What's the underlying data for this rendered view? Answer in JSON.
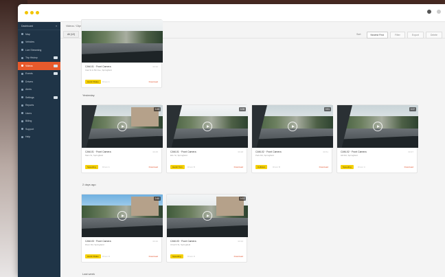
{
  "app": {
    "title": "Videos / Clips"
  },
  "sidebar": {
    "header": "Dashboard",
    "items": [
      {
        "label": "Map",
        "active": false,
        "badge": false
      },
      {
        "label": "Vehicles",
        "active": false,
        "badge": false
      },
      {
        "label": "Live Streaming",
        "active": false,
        "badge": false
      },
      {
        "label": "Trip History",
        "active": false,
        "badge": true
      },
      {
        "label": "Videos",
        "active": true,
        "badge": true
      },
      {
        "label": "Events",
        "active": false,
        "badge": true
      },
      {
        "label": "Drivers",
        "active": false,
        "badge": false
      },
      {
        "label": "Alerts",
        "active": false,
        "badge": false
      },
      {
        "label": "Settings",
        "active": false,
        "badge": true
      },
      {
        "label": "Reports",
        "active": false,
        "badge": false
      },
      {
        "label": "Users",
        "active": false,
        "badge": false
      },
      {
        "label": "Billing",
        "active": false,
        "badge": false
      },
      {
        "label": "Support",
        "active": false,
        "badge": false
      },
      {
        "label": "Help",
        "active": false,
        "badge": false
      }
    ]
  },
  "toolbar": {
    "breadcrumb": "Videos / Clips",
    "tabs": [
      "All (12)",
      "Uploaded",
      "Processing",
      "Requested"
    ],
    "sort_label": "Sort",
    "sort_value": "Newest First",
    "btn_filter": "Filter",
    "btn_export": "Export",
    "btn_delete": "Delete"
  },
  "groups": [
    {
      "title": ""
    },
    {
      "title": "Yesterday"
    },
    {
      "title": "2 days ago"
    },
    {
      "title": "Last week"
    }
  ],
  "cards": [
    {
      "title": "CAM-01 · Front Camera",
      "sub": "Oak St & 5th Ave, Springfield",
      "meta": "00:32",
      "tag": "Harsh Brake",
      "tag2": "Driver A",
      "action": "Download"
    },
    {
      "title": "CAM-01 · Front Camera",
      "sub": "Main St, Springfield",
      "meta": "00:45",
      "duration": "0:45",
      "tag": "Speeding",
      "tag2": "Driver A",
      "action": "Download"
    },
    {
      "title": "CAM-01 · Front Camera",
      "sub": "Elm St, Springfield",
      "meta": "00:28",
      "duration": "0:28",
      "tag": "Harsh Turn",
      "tag2": "Driver B",
      "action": "Download"
    },
    {
      "title": "CAM-02 · Front Camera",
      "sub": "Park Rd, Springfield",
      "meta": "00:51",
      "duration": "0:51",
      "tag": "Collision",
      "tag2": "Driver B",
      "action": "Download"
    },
    {
      "title": "CAM-02 · Front Camera",
      "sub": "Hill Rd, Springfield",
      "meta": "00:37",
      "duration": "0:37",
      "tag": "Speeding",
      "tag2": "Driver C",
      "action": "Download"
    },
    {
      "title": "CAM-03 · Front Camera",
      "sub": "River Rd, Springfield",
      "meta": "00:40",
      "duration": "0:40",
      "tag": "Harsh Brake",
      "tag2": "Driver D",
      "action": "Download"
    },
    {
      "title": "CAM-03 · Front Camera",
      "sub": "Church St, Springfield",
      "meta": "00:33",
      "duration": "0:33",
      "tag": "Speeding",
      "tag2": "Driver D",
      "action": "Download"
    }
  ]
}
